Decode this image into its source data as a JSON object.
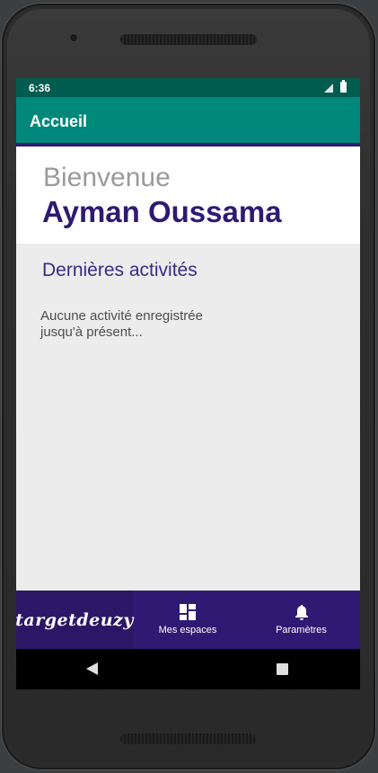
{
  "status_bar": {
    "time": "6:36"
  },
  "app_bar": {
    "title": "Accueil"
  },
  "welcome": {
    "greeting": "Bienvenue",
    "user_name": "Ayman Oussama"
  },
  "activities": {
    "title": "Dernières activités",
    "empty_line1": "Aucune activité enregistrée",
    "empty_line2": "jusqu'à présent..."
  },
  "bottom_nav": {
    "logo_text": "targetdeuzy",
    "items": [
      {
        "label": "Mes espaces",
        "icon": "dashboard-icon"
      },
      {
        "label": "Paramètres",
        "icon": "bell-icon"
      }
    ]
  },
  "system_nav": {
    "back_icon": "back-icon",
    "recents_icon": "recents-square-icon"
  },
  "colors": {
    "status_bar": "#005c4f",
    "app_bar": "#00897b",
    "accent_purple": "#2e1a72",
    "background": "#ececec"
  }
}
